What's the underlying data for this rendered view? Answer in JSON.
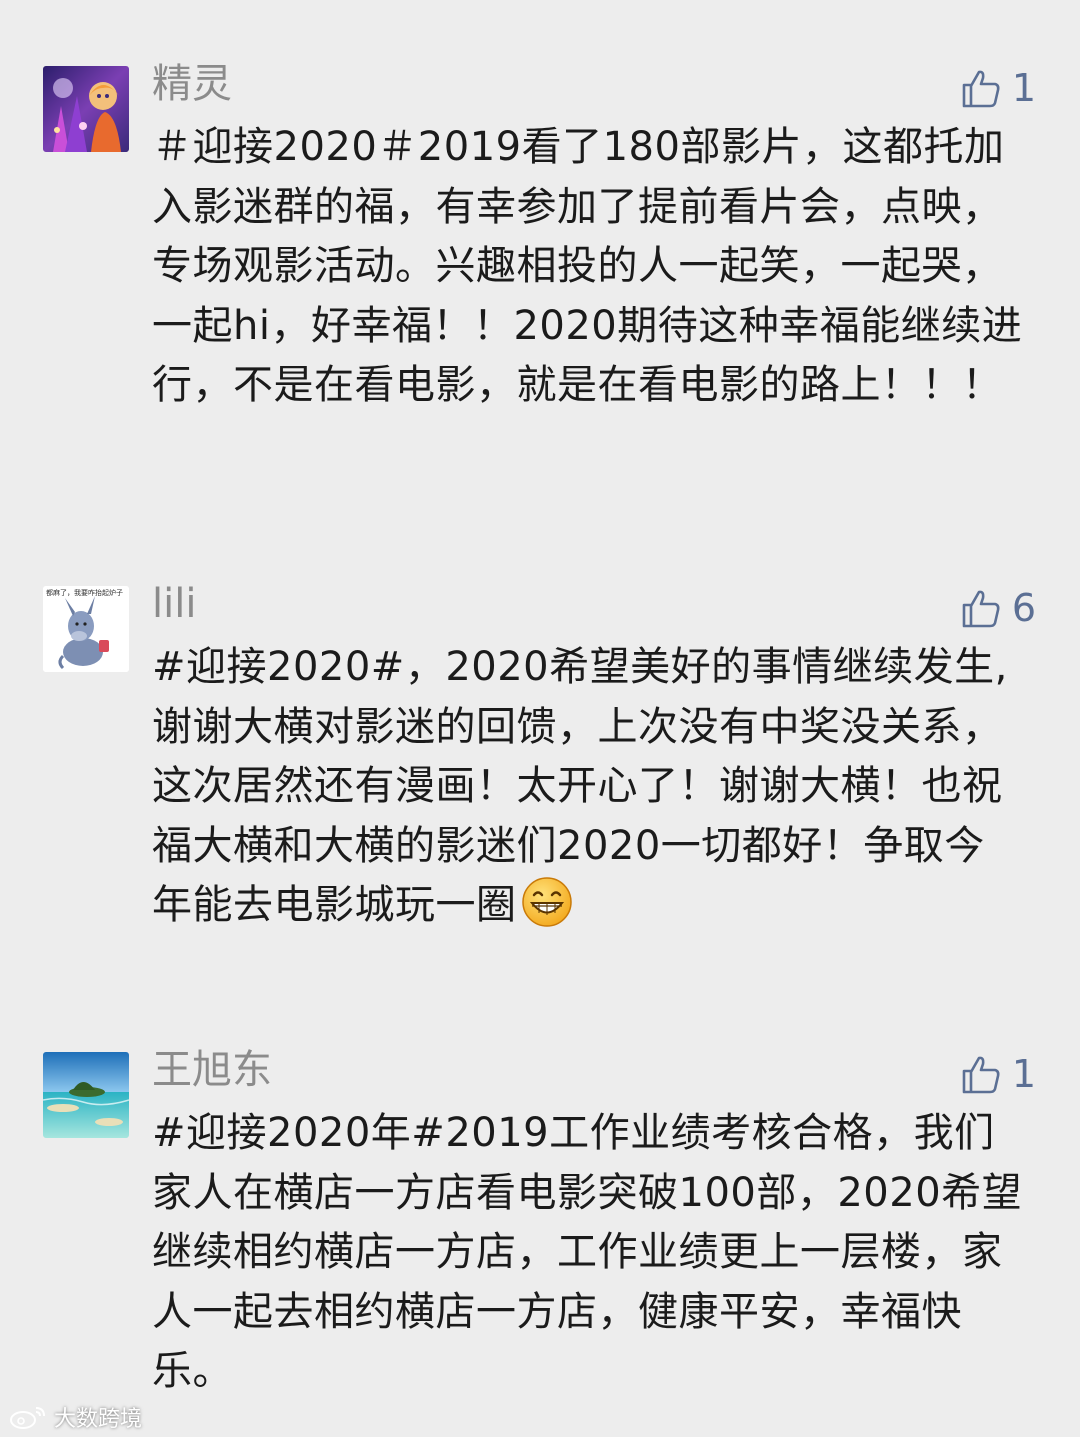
{
  "colors": {
    "background": "#ededed",
    "name": "#8b8b8b",
    "like_accent": "#5b6f94",
    "text": "#1b1b1b"
  },
  "comments": [
    {
      "name": "精灵",
      "likes": "1",
      "avatar_icon": "fairy-illustration-avatar",
      "text": "＃迎接2020＃2019看了180部影片，这都托加入影迷群的福，有幸参加了提前看片会，点映，专场观影活动。兴趣相投的人一起笑，一起哭，一起hi，好幸福！！2020期待这种幸福能继续进行，不是在看电影，就是在看电影的路上！！！"
    },
    {
      "name": "lili",
      "likes": "6",
      "avatar_icon": "eeyore-avatar",
      "avatar_caption": "都麻了，我要咋抬起炉子",
      "text": "#迎接2020#，2020希望美好的事情继续发生,谢谢大横对影迷的回馈，上次没有中奖没关系，这次居然还有漫画！太开心了！谢谢大横！也祝福大横和大横的影迷们2020一切都好！争取今年能去电影城玩一圈",
      "emoji": "grin-emoji"
    },
    {
      "name": "王旭东",
      "likes": "1",
      "avatar_icon": "beach-landscape-avatar",
      "text": "#迎接2020年#2019工作业绩考核合格，我们家人在横店一方店看电影突破100部，2020希望继续相约横店一方店，工作业绩更上一层楼，家人一起去相约横店一方店，健康平安，幸福快乐。"
    }
  ],
  "watermark": {
    "text": "大数跨境",
    "icon": "weibo-logo-icon"
  }
}
